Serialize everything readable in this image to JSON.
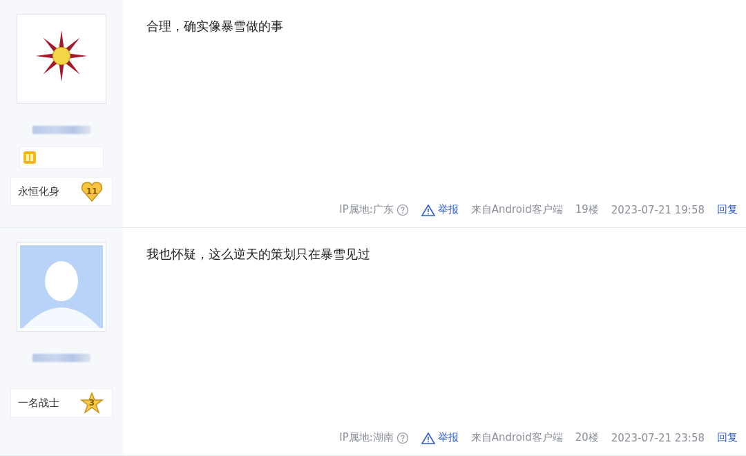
{
  "posts": [
    {
      "avatar": {
        "kind": "emblem"
      },
      "level_icon": true,
      "title": {
        "label": "永恒化身",
        "badge": {
          "kind": "heart",
          "number": "11"
        }
      },
      "content": "合理，确实像暴雪做的事",
      "footer": {
        "ip": "IP属地:广东",
        "report": "举报",
        "client": "来自Android客户端",
        "floor": "19楼",
        "time": "2023-07-21 19:58",
        "reply": "回复"
      }
    },
    {
      "avatar": {
        "kind": "default"
      },
      "level_icon": false,
      "title": {
        "label": "一名战士",
        "badge": {
          "kind": "star",
          "number": "3"
        }
      },
      "content": "我也怀疑，这么逆天的策划只在暴雪见过",
      "footer": {
        "ip": "IP属地:湖南",
        "report": "举报",
        "client": "来自Android客户端",
        "floor": "20楼",
        "time": "2023-07-21 23:58",
        "reply": "回复"
      }
    }
  ]
}
